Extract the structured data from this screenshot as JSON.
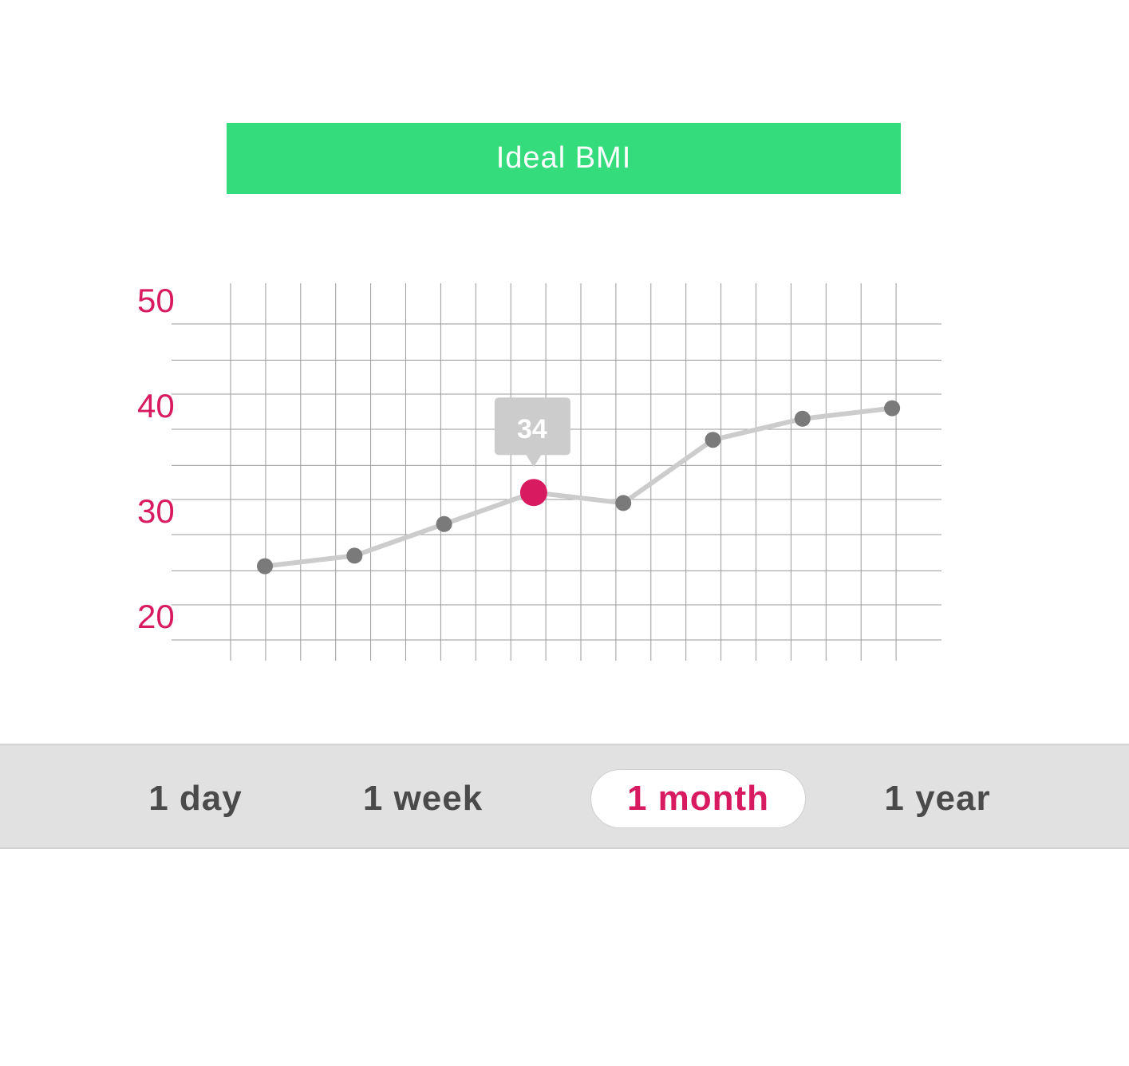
{
  "banner": {
    "label": "Ideal BMI",
    "color": "#35dc7c"
  },
  "chart_data": {
    "type": "line",
    "x": [
      1,
      2,
      3,
      4,
      5,
      6,
      7,
      8
    ],
    "values": [
      27,
      28,
      31,
      34,
      33,
      39,
      41,
      42
    ],
    "yticks": [
      "20",
      "30",
      "40",
      "50"
    ],
    "ylim": [
      20,
      50
    ],
    "grid": true,
    "highlight_index": 3,
    "tooltip": "34",
    "line_color": "#cccccc",
    "point_color": "#7a7a7a",
    "highlight_color": "#d81b60",
    "tick_color": "#d81b60"
  },
  "range_selector": {
    "options": [
      {
        "label": "1 day",
        "active": false
      },
      {
        "label": "1 week",
        "active": false
      },
      {
        "label": "1 month",
        "active": true
      },
      {
        "label": "1 year",
        "active": false
      }
    ]
  }
}
